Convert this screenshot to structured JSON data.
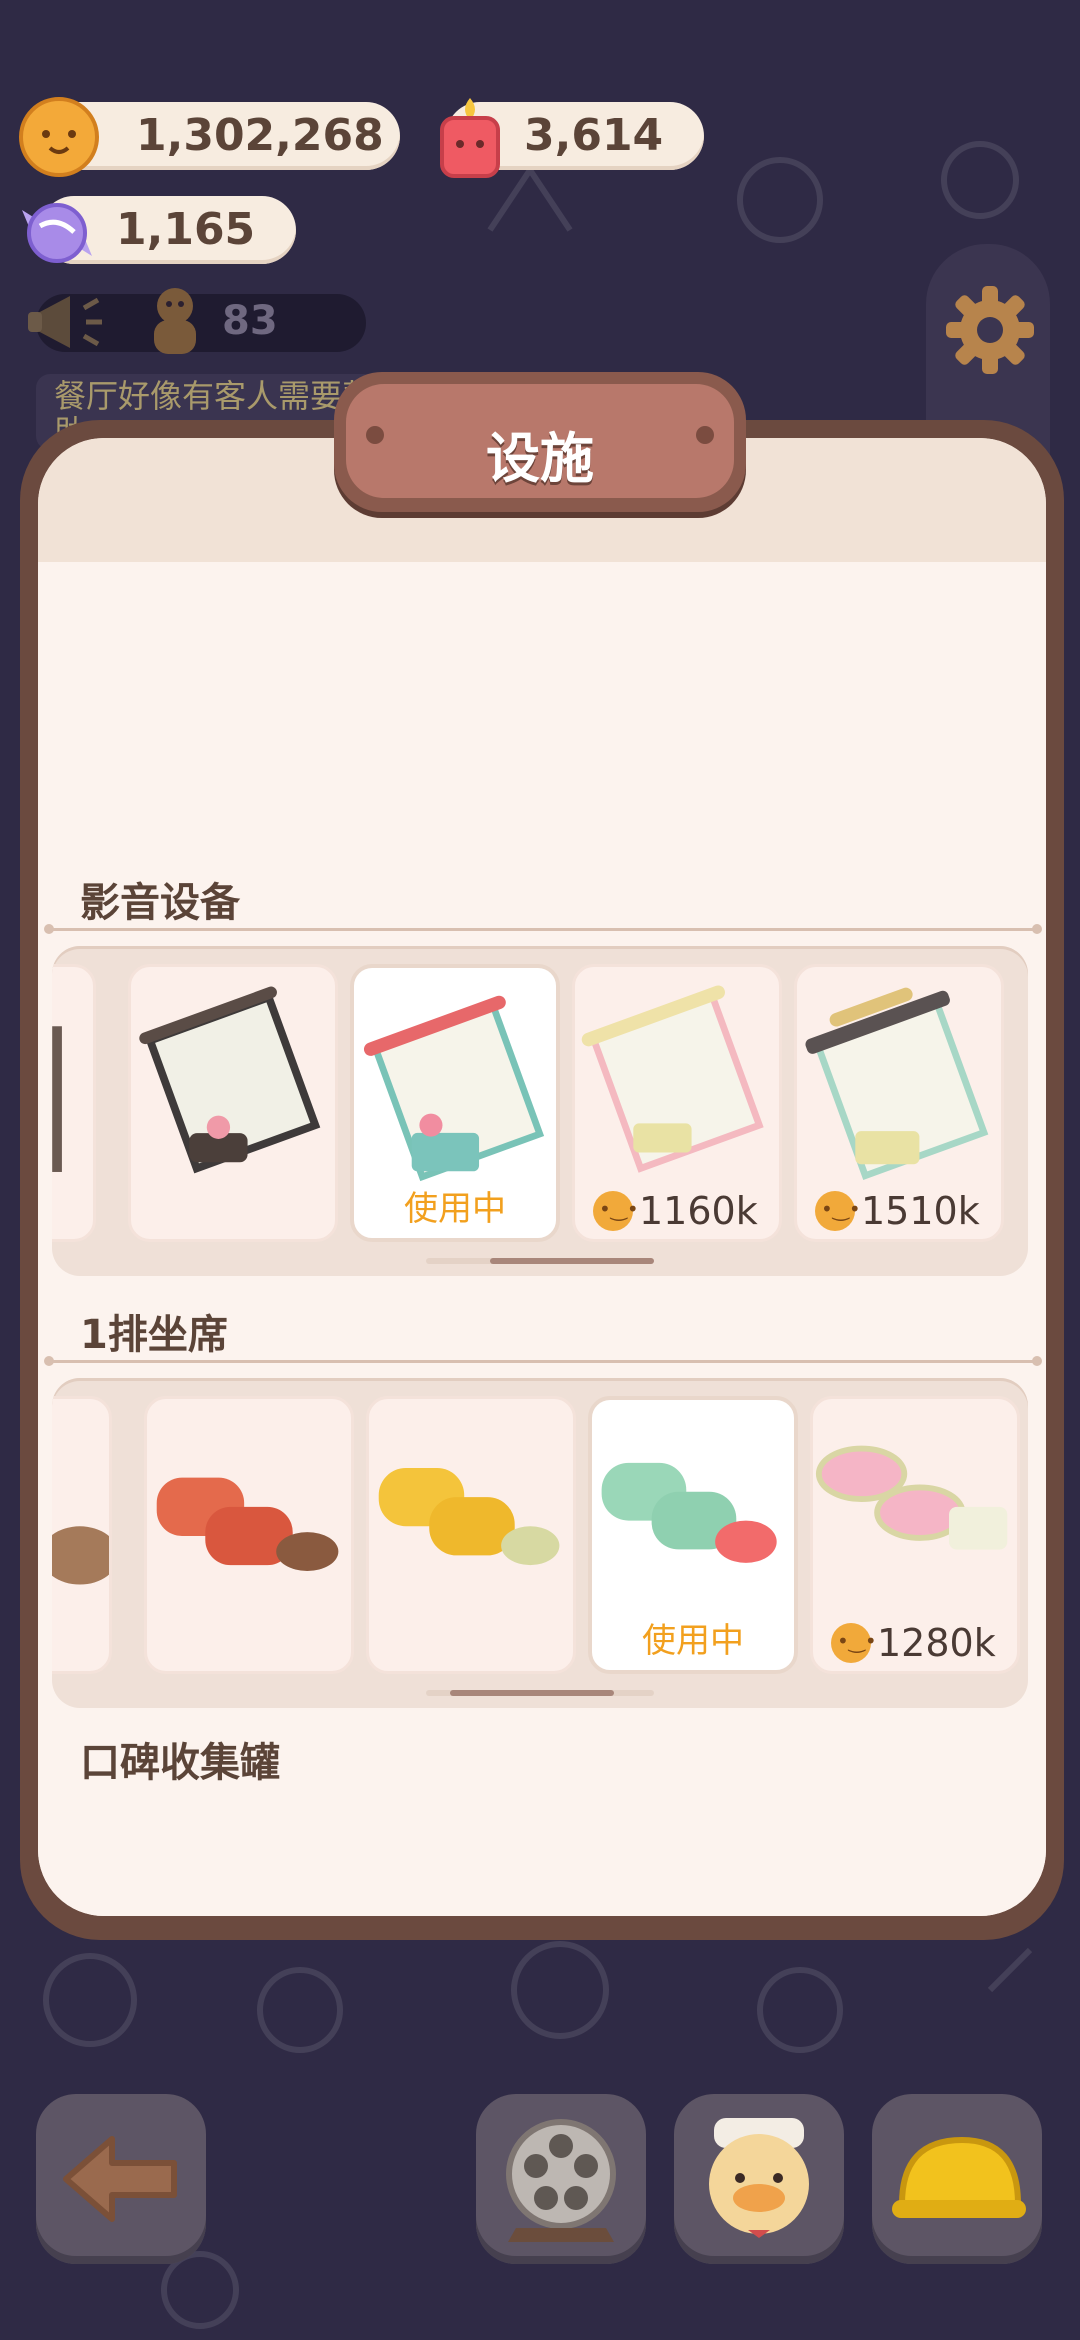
{
  "resources": {
    "coins": "1,302,268",
    "candles": "3,614",
    "candy": "1,165",
    "guests": "83"
  },
  "hint_text": "餐厅好像有客人需要帮助",
  "panel": {
    "title": "设施"
  },
  "sections": [
    {
      "title": "影音设备",
      "items": [
        {
          "status": "",
          "price": ""
        },
        {
          "status": "",
          "price": ""
        },
        {
          "status": "使用中",
          "price": ""
        },
        {
          "status": "",
          "price": "1160k"
        },
        {
          "status": "",
          "price": "1510k"
        }
      ]
    },
    {
      "title": "1排坐席",
      "items": [
        {
          "status": "",
          "price": ""
        },
        {
          "status": "",
          "price": ""
        },
        {
          "status": "",
          "price": ""
        },
        {
          "status": "使用中",
          "price": ""
        },
        {
          "status": "",
          "price": "1280k"
        }
      ]
    },
    {
      "title": "口碑收集罐"
    }
  ],
  "icons": {
    "settings": "gear-icon",
    "back": "arrow-left-icon",
    "film": "film-reel-icon",
    "chef": "duck-chef-icon",
    "hardhat": "hardhat-icon"
  },
  "colors": {
    "background": "#2f2a45",
    "accent": "#f2a01e",
    "panel_border": "#6b4a3f"
  }
}
